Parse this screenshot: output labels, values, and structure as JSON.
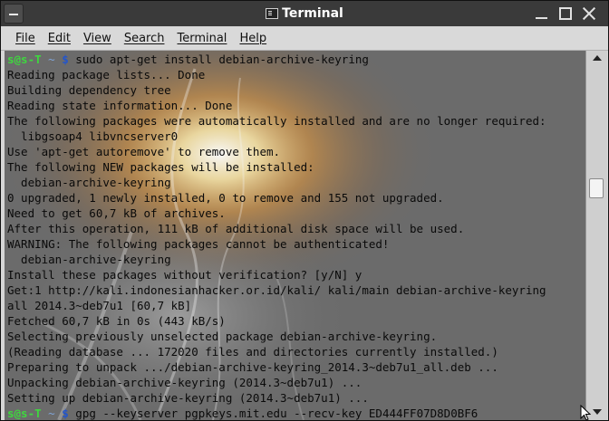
{
  "window": {
    "title": "Terminal"
  },
  "menu": {
    "items": [
      "File",
      "Edit",
      "View",
      "Search",
      "Terminal",
      "Help"
    ]
  },
  "terminal": {
    "prompt": {
      "user_host": "s@s-T",
      "path": "~",
      "dollar": "$"
    },
    "lines": [
      {
        "type": "prompt",
        "command": "sudo apt-get install debian-archive-keyring"
      },
      {
        "type": "output",
        "text": "Reading package lists... Done"
      },
      {
        "type": "output",
        "text": "Building dependency tree"
      },
      {
        "type": "output",
        "text": "Reading state information... Done"
      },
      {
        "type": "output",
        "text": "The following packages were automatically installed and are no longer required:"
      },
      {
        "type": "output",
        "text": "  libgsoap4 libvncserver0"
      },
      {
        "type": "output",
        "text": "Use 'apt-get autoremove' to remove them."
      },
      {
        "type": "output",
        "text": "The following NEW packages will be installed:"
      },
      {
        "type": "output",
        "text": "  debian-archive-keyring"
      },
      {
        "type": "output",
        "text": "0 upgraded, 1 newly installed, 0 to remove and 155 not upgraded."
      },
      {
        "type": "output",
        "text": "Need to get 60,7 kB of archives."
      },
      {
        "type": "output",
        "text": "After this operation, 111 kB of additional disk space will be used."
      },
      {
        "type": "output",
        "text": "WARNING: The following packages cannot be authenticated!"
      },
      {
        "type": "output",
        "text": "  debian-archive-keyring"
      },
      {
        "type": "output",
        "text": "Install these packages without verification? [y/N] y"
      },
      {
        "type": "output",
        "text": "Get:1 http://kali.indonesianhacker.or.id/kali/ kali/main debian-archive-keyring"
      },
      {
        "type": "output",
        "text": "all 2014.3~deb7u1 [60,7 kB]"
      },
      {
        "type": "output",
        "text": "Fetched 60,7 kB in 0s (443 kB/s)"
      },
      {
        "type": "output",
        "text": "Selecting previously unselected package debian-archive-keyring."
      },
      {
        "type": "output",
        "text": "(Reading database ... 172020 files and directories currently installed.)"
      },
      {
        "type": "output",
        "text": "Preparing to unpack .../debian-archive-keyring_2014.3~deb7u1_all.deb ..."
      },
      {
        "type": "output",
        "text": "Unpacking debian-archive-keyring (2014.3~deb7u1) ..."
      },
      {
        "type": "output",
        "text": "Setting up debian-archive-keyring (2014.3~deb7u1) ..."
      },
      {
        "type": "prompt",
        "command": "gpg --keyserver pgpkeys.mit.edu --recv-key ED444FF07D8D0BF6"
      }
    ]
  },
  "colors": {
    "titlebar": "#3a3a3a",
    "terminal_bg": "#6b6b6b",
    "prompt_user": "#3fd63f",
    "prompt_path": "#7fa5d8",
    "prompt_dollar": "#2255cc"
  },
  "icons": {
    "window_menu": "window-menu-icon",
    "app": "terminal-icon",
    "minimize": "minimize-icon",
    "maximize": "maximize-icon",
    "close": "close-icon",
    "scroll_up": "arrow-up-icon",
    "scroll_down": "arrow-down-icon",
    "cursor": "mouse-pointer-icon"
  }
}
